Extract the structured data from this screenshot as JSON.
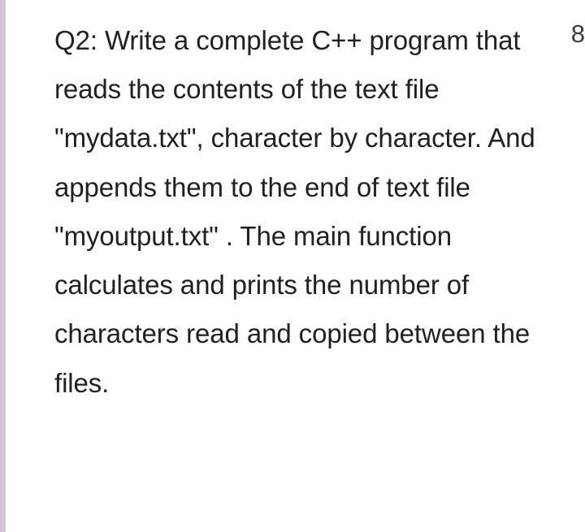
{
  "question": {
    "body": "Q2: Write a complete C++ program that reads the contents of the text file \"mydata.txt\", character by character. And appends them to the end of text file \"myoutput.txt\" . The main function calculates and prints the number of characters read and copied between the files."
  },
  "corner_glyph": "8"
}
